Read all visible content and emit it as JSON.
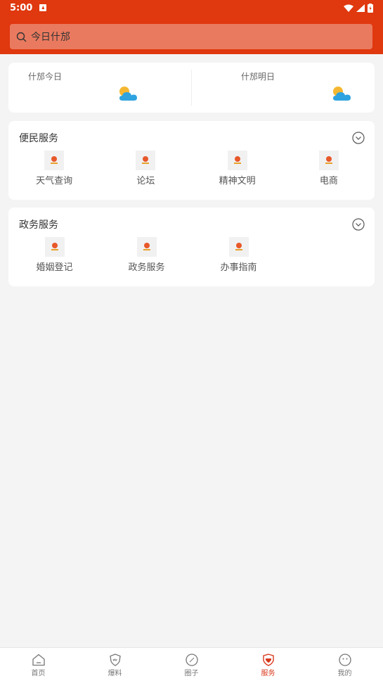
{
  "status_bar": {
    "time": "5:00"
  },
  "search": {
    "placeholder": "今日什邡"
  },
  "weather": {
    "today_label": "什邡今日",
    "tomorrow_label": "什邡明日"
  },
  "sections": [
    {
      "title": "便民服务",
      "items": [
        {
          "label": "天气查询"
        },
        {
          "label": "论坛"
        },
        {
          "label": "精神文明"
        },
        {
          "label": "电商"
        }
      ]
    },
    {
      "title": "政务服务",
      "items": [
        {
          "label": "婚姻登记"
        },
        {
          "label": "政务服务"
        },
        {
          "label": "办事指南"
        }
      ]
    }
  ],
  "bottom_nav": {
    "items": [
      {
        "label": "首页",
        "icon": "home-icon"
      },
      {
        "label": "爆料",
        "icon": "shield-icon"
      },
      {
        "label": "圈子",
        "icon": "compass-icon"
      },
      {
        "label": "服务",
        "icon": "service-badge-icon",
        "active": true
      },
      {
        "label": "我的",
        "icon": "face-icon"
      }
    ]
  },
  "colors": {
    "primary": "#e0380f",
    "active": "#d8371a",
    "weather_sun": "#f5b731",
    "weather_cloud": "#2ea3e0"
  }
}
